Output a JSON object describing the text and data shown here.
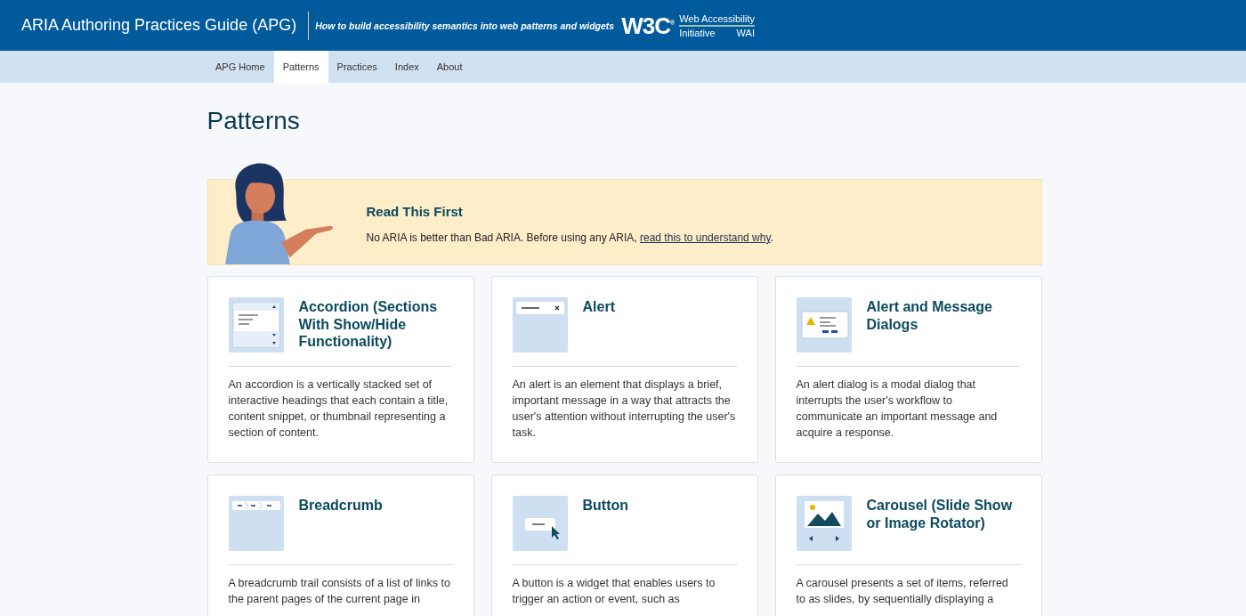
{
  "header": {
    "title": "ARIA Authoring Practices Guide (APG)",
    "tagline": "How to build accessibility semantics into web patterns and widgets",
    "logo": {
      "mark": "W3C",
      "registered": "®",
      "line1": "Web Accessibility",
      "line2_left": "Initiative",
      "line2_right": "WAI"
    }
  },
  "nav": [
    {
      "label": "APG Home",
      "selected": false
    },
    {
      "label": "Patterns",
      "selected": true
    },
    {
      "label": "Practices",
      "selected": false
    },
    {
      "label": "Index",
      "selected": false
    },
    {
      "label": "About",
      "selected": false
    }
  ],
  "page_title": "Patterns",
  "notice": {
    "title": "Read This First",
    "text": "No ARIA is better than Bad ARIA. Before using any ARIA, ",
    "link": "read this to understand why",
    "after": "."
  },
  "cards": [
    {
      "kind": "accordion",
      "title": "Accordion (Sections With Show/Hide Functionality)",
      "description": "An accordion is a vertically stacked set of interactive headings that each contain a title, content snippet, or thumbnail representing a section of content."
    },
    {
      "kind": "alert",
      "title": "Alert",
      "description": "An alert is an element that displays a brief, important message in a way that attracts the user's attention without interrupting the user's task."
    },
    {
      "kind": "dialog",
      "title": "Alert and Message Dialogs",
      "description": "An alert dialog is a modal dialog that interrupts the user's workflow to communicate an important message and acquire a response."
    },
    {
      "kind": "breadcrumb",
      "title": "Breadcrumb",
      "description": "A breadcrumb trail consists of a list of links to the parent pages of the current page in"
    },
    {
      "kind": "button",
      "title": "Button",
      "description": "A button is a widget that enables users to trigger an action or event, such as"
    },
    {
      "kind": "carousel",
      "title": "Carousel (Slide Show or Image Rotator)",
      "description": "A carousel presents a set of items, referred to as slides, by sequentially displaying a"
    }
  ]
}
